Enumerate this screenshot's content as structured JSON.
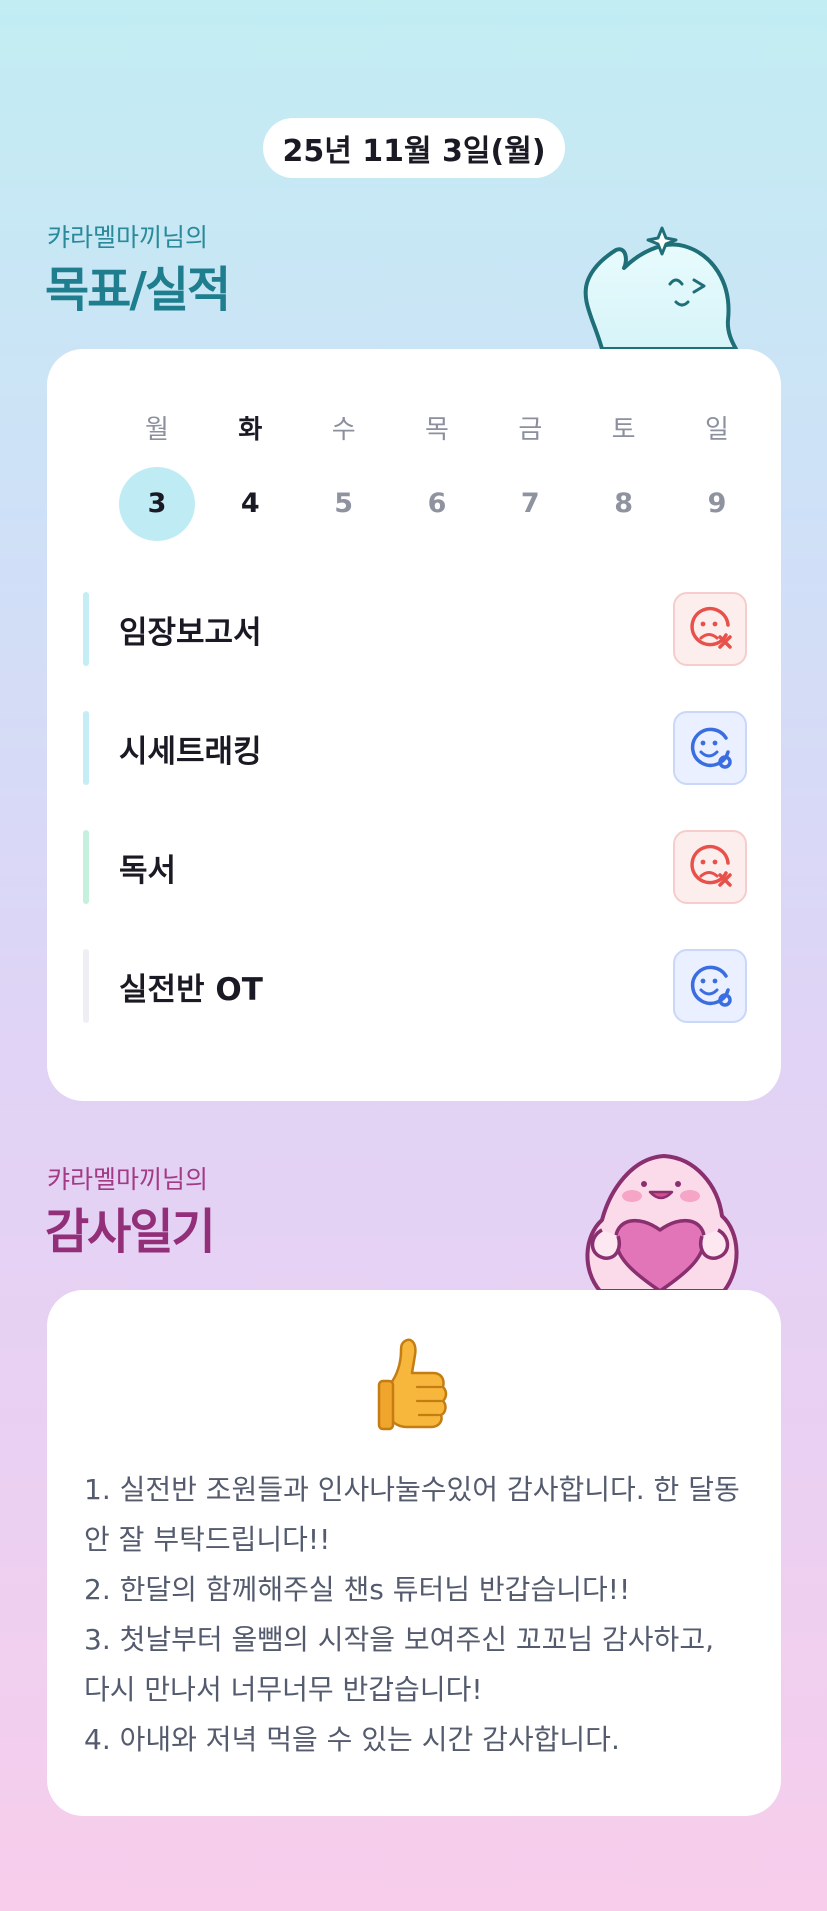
{
  "date_label": "25년 11월 3일(월)",
  "goals_section": {
    "subtitle": "캬라멜마끼님의",
    "title": "목표/실적",
    "weekdays": [
      "월",
      "화",
      "수",
      "목",
      "금",
      "토",
      "일"
    ],
    "dates": [
      "3",
      "4",
      "5",
      "6",
      "7",
      "8",
      "9"
    ],
    "selected_date": "3",
    "items": [
      {
        "label": "임장보고서",
        "status": "fail-icon",
        "bar_color": "#c4edf5"
      },
      {
        "label": "시세트래킹",
        "status": "done-icon",
        "bar_color": "#c4edf5"
      },
      {
        "label": "독서",
        "status": "fail-icon",
        "bar_color": "#c5f0de"
      },
      {
        "label": "실전반 OT",
        "status": "done-icon",
        "bar_color": "#eeeef4"
      }
    ]
  },
  "gratitude_section": {
    "subtitle": "캬라멜마끼님의",
    "title": "감사일기",
    "emoji": "thumbs-up-icon",
    "lines": [
      "1. 실전반 조원들과 인사나눌수있어 감사합니다. 한 달동안 잘 부탁드립니다!!",
      "2. 한달의 함께해주실 챈s 튜터님 반갑습니다!!",
      "3. 첫날부터 올뺌의 시작을 보여주신 꼬꼬님 감사하고, 다시 만나서 너무너무 반갑습니다!",
      "4. 아내와 저녁 먹을 수 있는 시간 감사합니다."
    ]
  },
  "colors": {
    "goal_accent": "#1e7e8e",
    "gratitude_accent": "#922f78",
    "fail": "#e8504a",
    "done": "#3a6ee0"
  }
}
